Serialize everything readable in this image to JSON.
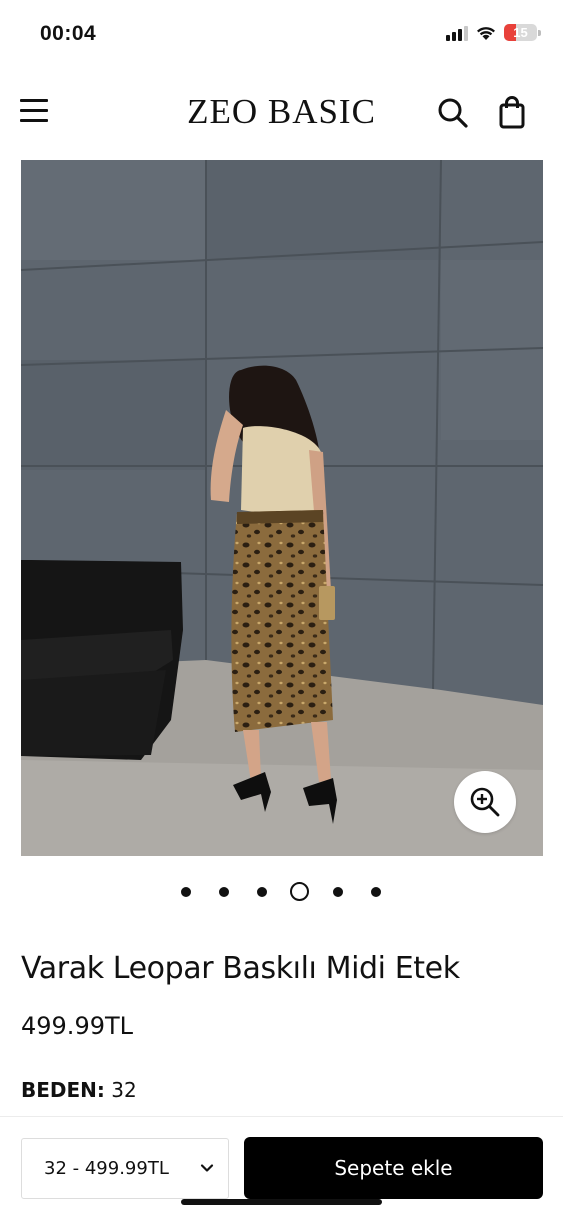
{
  "status_bar": {
    "time": "00:04",
    "battery_level": "15",
    "icons": [
      "signal-icon",
      "wifi-icon",
      "battery-icon"
    ]
  },
  "header": {
    "logo": "ZEO BASIC",
    "icons": [
      "menu-icon",
      "search-icon",
      "shopping-bag-icon"
    ]
  },
  "gallery": {
    "image_count": 6,
    "active_index": 3,
    "zoom_icon": "zoom-in-icon"
  },
  "product": {
    "title": "Varak Leopar Baskılı Midi Etek",
    "price": "499.99TL",
    "size_label": "BEDEN:",
    "size_value": "32"
  },
  "bottom_bar": {
    "size_select_value": "32 - 499.99TL",
    "add_to_cart_label": "Sepete ekle"
  },
  "colors": {
    "accent": "#000000",
    "battery_low": "#e8413a",
    "background": "#ffffff"
  }
}
